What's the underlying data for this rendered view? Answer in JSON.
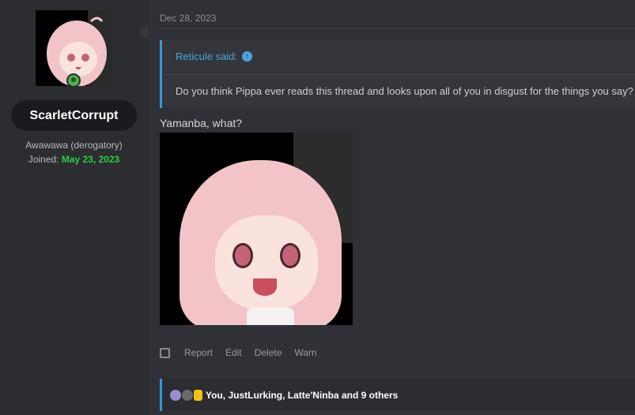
{
  "user": {
    "name": "ScarletCorrupt",
    "title": "Awawawa (derogatory)",
    "joined_label": "Joined: ",
    "joined_date": "May 23, 2023"
  },
  "message": {
    "date": "Dec 28, 2023",
    "quote": {
      "author_line": "Reticule said:",
      "text": "Do you think Pippa ever reads this thread and looks upon all of you in disgust for the things you say?"
    },
    "body": "Yamanba, what?"
  },
  "actions": {
    "report": "Report",
    "edit": "Edit",
    "delete": "Delete",
    "warn": "Warn"
  },
  "reactions": {
    "summary": "You, JustLurking, Latte'Ninba and 9 others"
  },
  "colors": {
    "accent": "#3498db",
    "joined_date": "#2ecc40",
    "online": "#4caf50"
  }
}
